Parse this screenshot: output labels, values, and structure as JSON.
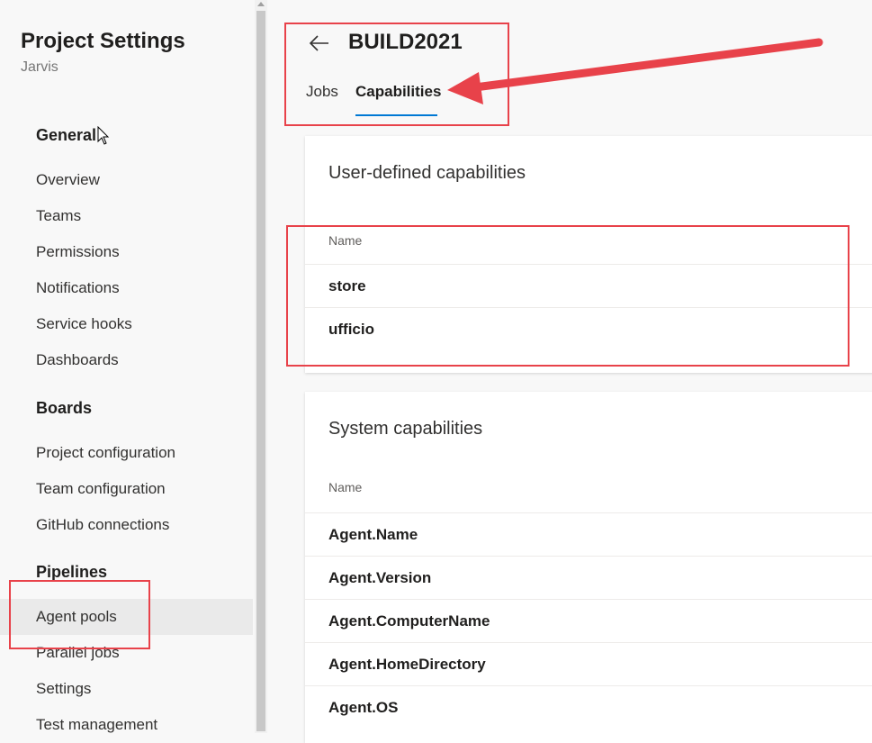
{
  "sidebar": {
    "title": "Project Settings",
    "subtitle": "Jarvis",
    "groups": [
      {
        "heading": "General",
        "items": [
          "Overview",
          "Teams",
          "Permissions",
          "Notifications",
          "Service hooks",
          "Dashboards"
        ]
      },
      {
        "heading": "Boards",
        "items": [
          "Project configuration",
          "Team configuration",
          "GitHub connections"
        ]
      },
      {
        "heading": "Pipelines",
        "items": [
          "Agent pools",
          "Parallel jobs",
          "Settings",
          "Test management"
        ]
      }
    ],
    "selected_item": "Agent pools"
  },
  "header": {
    "back_icon": "arrow-left-icon",
    "title": "BUILD2021",
    "tabs": [
      {
        "label": "Jobs",
        "active": false
      },
      {
        "label": "Capabilities",
        "active": true
      }
    ]
  },
  "user_capabilities": {
    "title": "User-defined capabilities",
    "column": "Name",
    "rows": [
      "store",
      "ufficio"
    ]
  },
  "system_capabilities": {
    "title": "System capabilities",
    "column": "Name",
    "rows": [
      "Agent.Name",
      "Agent.Version",
      "Agent.ComputerName",
      "Agent.HomeDirectory",
      "Agent.OS"
    ]
  },
  "colors": {
    "accent": "#0078d4",
    "annotation": "#e8424a",
    "selected_bg": "#eaeaea"
  }
}
